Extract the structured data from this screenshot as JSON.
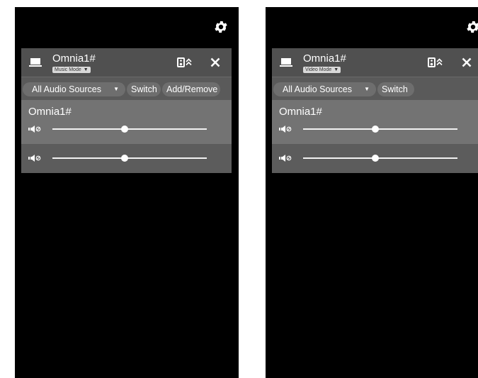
{
  "colors": {
    "background": "#000000",
    "panel": "#5d5d5d",
    "header": "#505050",
    "room_section": "#737373",
    "pill": "#6e6e6e",
    "text": "#ffffff"
  },
  "icons": {
    "settings": "gear-icon",
    "device": "laptop-icon",
    "speakers": "speaker-expand-icon",
    "close": "close-icon",
    "volume": "volume-icon"
  },
  "screens": [
    {
      "device_name": "Omnia1#",
      "mode_label": "Music Mode",
      "source_label": "All Audio Sources",
      "switch_label": "Switch",
      "add_remove_label": "Add/Remove",
      "room_name": "Omnia1#",
      "volumes": [
        0.47,
        0.47
      ]
    },
    {
      "device_name": "Omnia1#",
      "mode_label": "Video Mode",
      "source_label": "All Audio Sources",
      "switch_label": "Switch",
      "room_name": "Omnia1#",
      "volumes": [
        0.47,
        0.47
      ]
    }
  ]
}
